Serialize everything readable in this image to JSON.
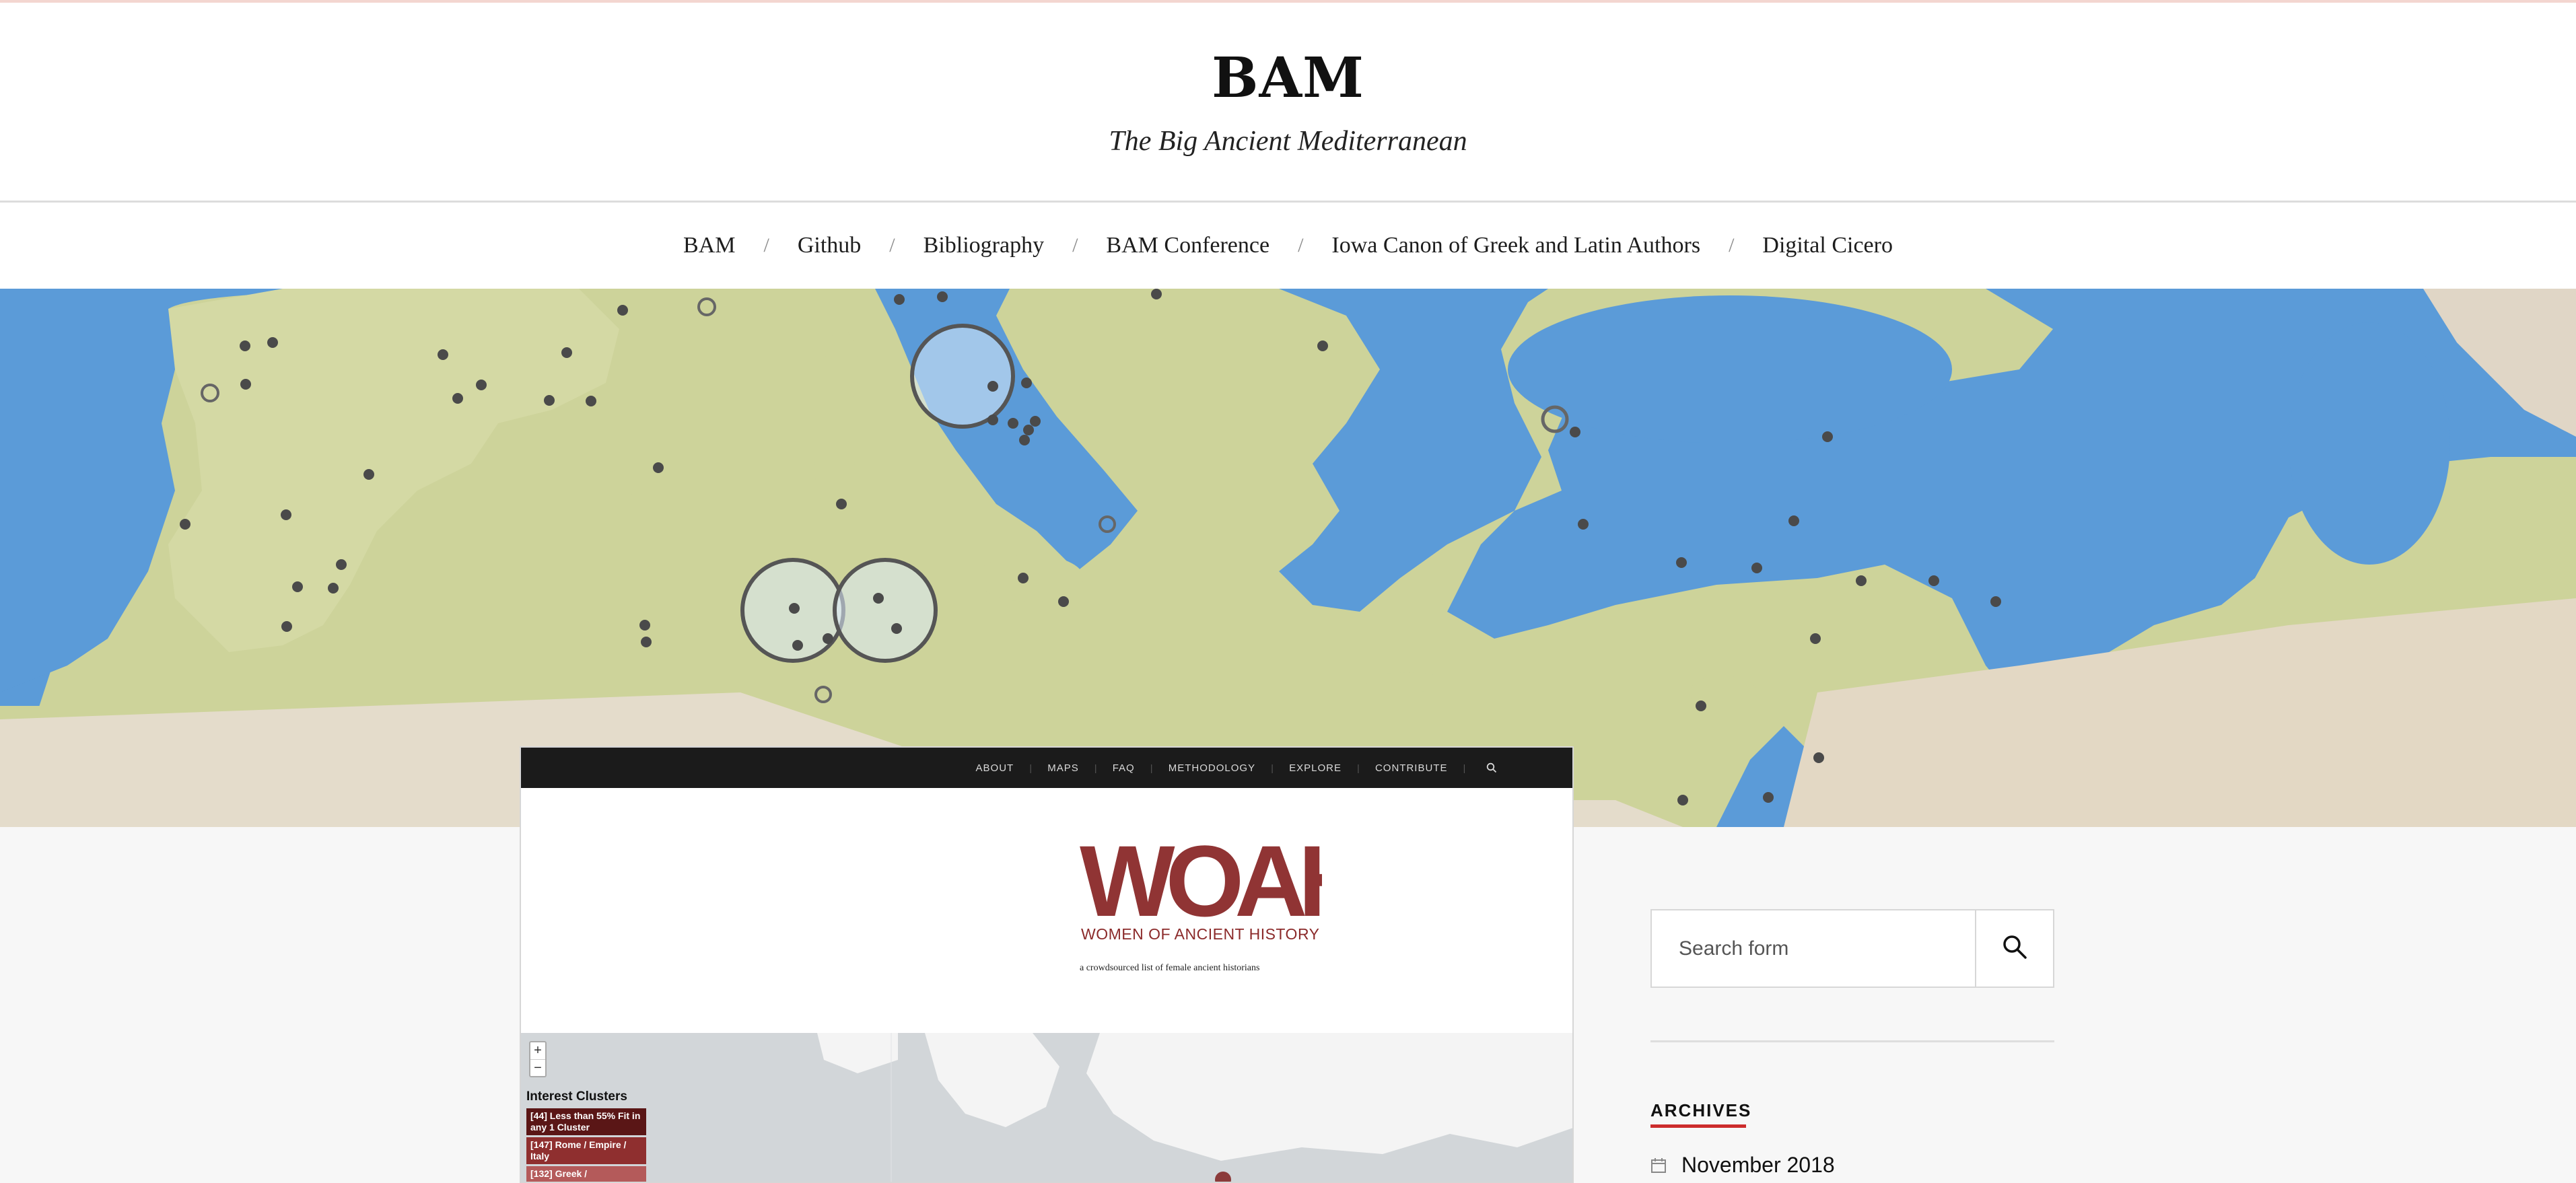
{
  "site": {
    "title": "BAM",
    "tagline": "The Big Ancient Mediterranean"
  },
  "nav": {
    "items": [
      {
        "label": "BAM"
      },
      {
        "label": "Github"
      },
      {
        "label": "Bibliography"
      },
      {
        "label": "BAM Conference"
      },
      {
        "label": "Iowa Canon of Greek and Latin Authors"
      },
      {
        "label": "Digital Cicero"
      }
    ],
    "separator": "/"
  },
  "post": {
    "woah_nav": [
      "ABOUT",
      "MAPS",
      "FAQ",
      "METHODOLOGY",
      "EXPLORE",
      "CONTRIBUTE"
    ],
    "woah_nav_separator": "|",
    "logo_letters": "WOAH",
    "logo_name": "WOMEN OF ANCIENT HISTORY",
    "logo_tagline": "a crowdsourced list of female ancient historians",
    "map": {
      "zoom_in": "+",
      "zoom_out": "−",
      "clusters_title": "Interest Clusters",
      "clusters": [
        {
          "label": "[44] Less than 55% Fit in any 1 Cluster",
          "color": "#5a1616"
        },
        {
          "label": "[147] Rome / Empire / Italy",
          "color": "#8f2f2f"
        },
        {
          "label": "[132] Greek /",
          "color": "#b45a5a"
        }
      ]
    }
  },
  "sidebar": {
    "search_placeholder": "Search form",
    "archives_title": "ARCHIVES",
    "archives": [
      {
        "label": "November 2018"
      }
    ]
  },
  "colors": {
    "sea": "#5b9bd8",
    "land": "#cfd49a",
    "accent_red": "#cc2c2c",
    "woah_red": "#8b2a2a"
  },
  "icons": [
    "search-icon",
    "calendar-icon",
    "woah-search-icon"
  ]
}
